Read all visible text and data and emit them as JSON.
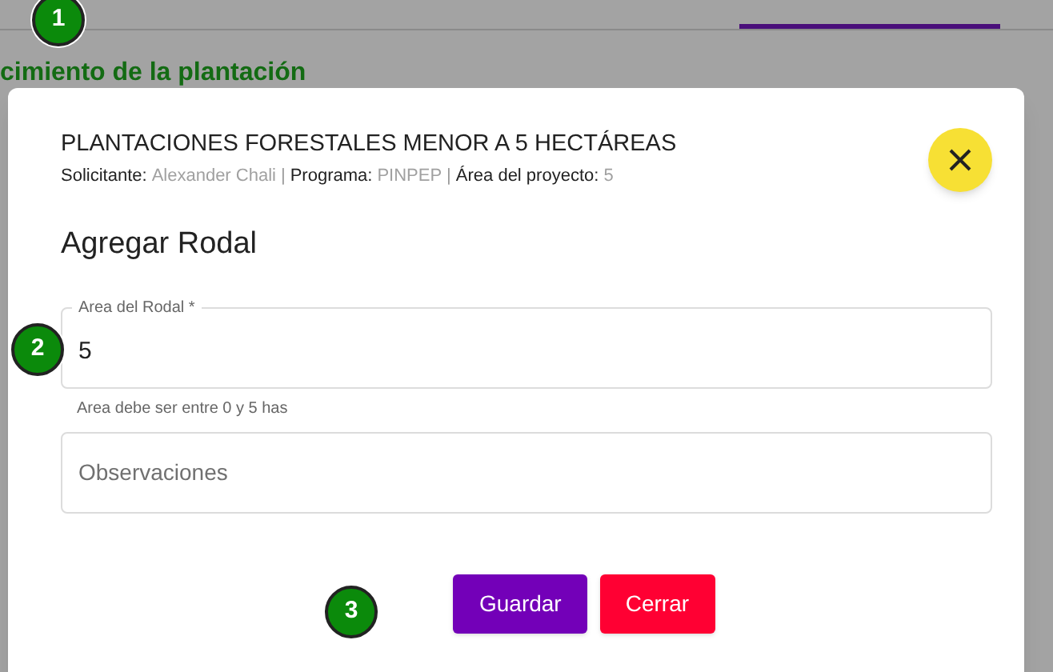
{
  "background": {
    "section_heading": "cimiento de la plantación"
  },
  "dialog": {
    "title": "PLANTACIONES FORESTALES MENOR A 5 HECTÁREAS",
    "details": [
      {
        "label": "Solicitante:",
        "value": "Alexander Chali"
      },
      {
        "label": "Programa:",
        "value": "PINPEP"
      },
      {
        "label": "Área del proyecto:",
        "value": "5"
      }
    ],
    "separator": "|",
    "heading": "Agregar Rodal",
    "fields": [
      {
        "label": "Area del Rodal *",
        "value": "5",
        "helper": "Area debe ser entre 0 y 5 has"
      },
      {
        "placeholder": "Observaciones"
      }
    ],
    "buttons": [
      {
        "label": "Guardar",
        "kind": "primary"
      },
      {
        "label": "Cerrar",
        "kind": "danger"
      }
    ]
  },
  "step_markers": [
    "1",
    "2",
    "3"
  ]
}
